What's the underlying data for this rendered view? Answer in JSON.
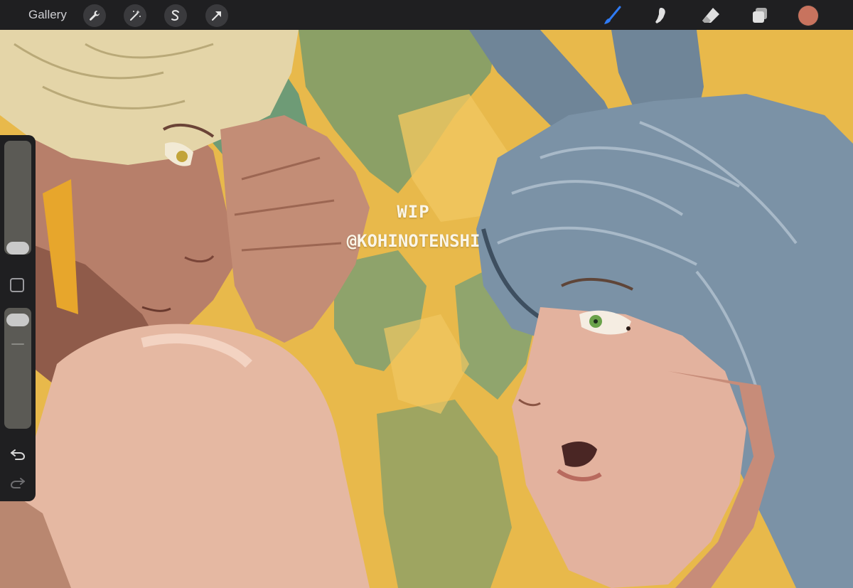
{
  "topbar": {
    "gallery_label": "Gallery",
    "left_tools": [
      "actions-wrench-icon",
      "adjustments-wand-icon",
      "selection-s-icon",
      "transform-arrow-icon"
    ],
    "right_tools": [
      "brush-icon",
      "smudge-icon",
      "eraser-icon",
      "layers-icon",
      "color-swatch"
    ],
    "brush_active_color": "#2f7bf5",
    "current_color": "#c8735e"
  },
  "sidebar": {
    "brush_size_level": 0.0,
    "opacity_level": 1.0,
    "tools": [
      "modify-square",
      "undo-icon",
      "redo-icon"
    ]
  },
  "canvas": {
    "watermark": {
      "line1": "WIP",
      "line2": "@KOHINOTENSHI"
    },
    "colors": {
      "background_yellow": "#e8b94b",
      "background_green": "#8aa267",
      "skin_left": "#b9826c",
      "skin_right": "#e3b29e",
      "hair_blonde": "#e4d5a8",
      "hair_blue": "#7b92a6",
      "eye_green": "#6aa24a"
    }
  }
}
